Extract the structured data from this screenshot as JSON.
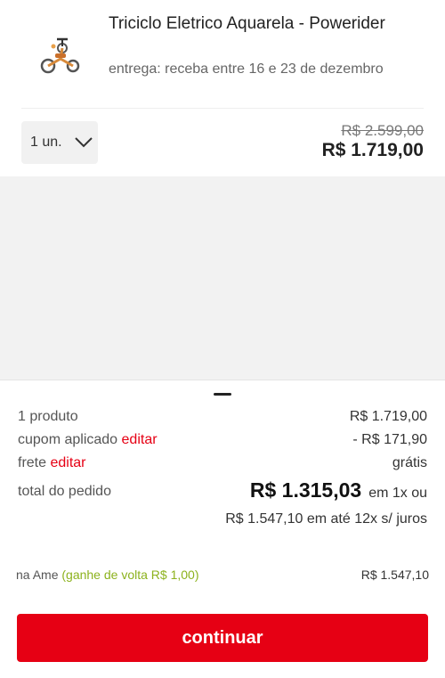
{
  "product": {
    "title": "Triciclo Eletrico Aquarela - Powerider",
    "delivery": "entrega: receba entre 16 e 23 de dezembro",
    "quantity": "1 un.",
    "old_price": "R$ 2.599,00",
    "price": "R$ 1.719,00",
    "image_icon": "tricycle-product-image"
  },
  "summary": {
    "products_label": "1 produto",
    "products_value": "R$ 1.719,00",
    "coupon_label": "cupom aplicado",
    "coupon_edit": "editar",
    "coupon_value": "- R$ 171,90",
    "shipping_label": "frete",
    "shipping_edit": "editar",
    "shipping_value": "grátis",
    "total_label": "total do pedido",
    "total_value": "R$ 1.315,03",
    "total_suffix": "em 1x ou",
    "installments": "R$ 1.547,10 em até 12x s/ juros",
    "ame_label": "na Ame",
    "ame_cashback": "(ganhe de volta R$ 1,00)",
    "ame_value": "R$ 1.547,10"
  },
  "actions": {
    "continue_label": "continuar"
  },
  "colors": {
    "accent_red": "#e60014",
    "discount_green": "#8cb21d"
  }
}
